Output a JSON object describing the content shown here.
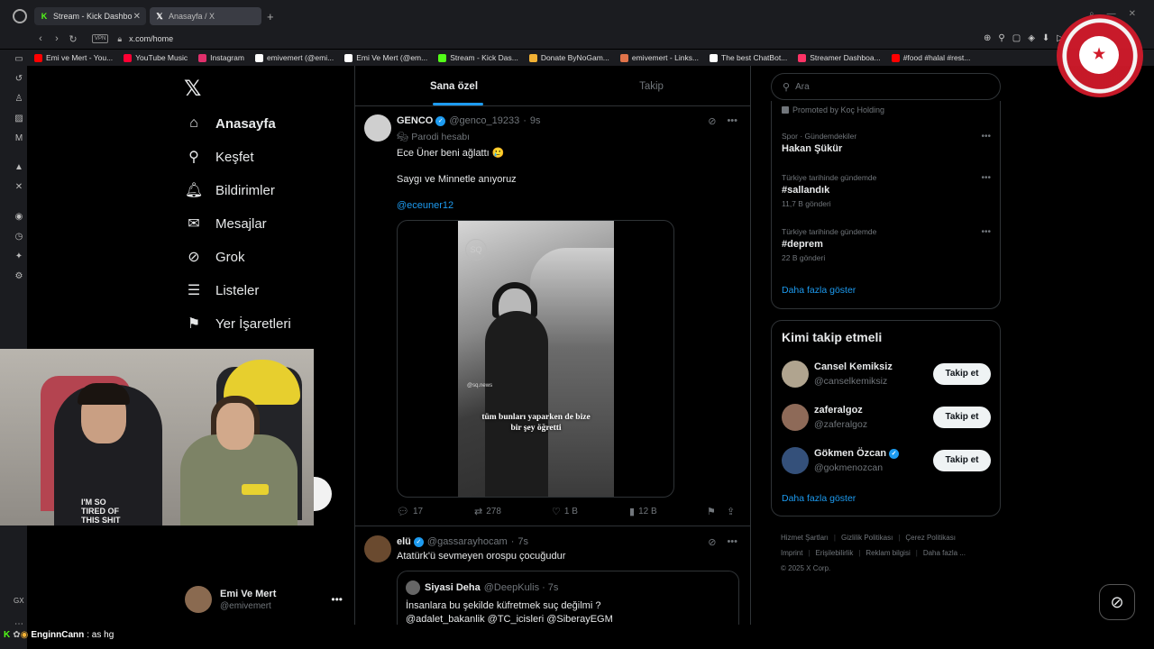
{
  "browser": {
    "tabs": [
      {
        "label": "Stream - Kick Dashbo",
        "active": true
      },
      {
        "label": "Anasayfa / X",
        "active": false
      }
    ],
    "address": "x.com/home",
    "vpn": "VPN",
    "bookmarks": [
      {
        "label": "Emi ve Mert - You...",
        "color": "#ff0000"
      },
      {
        "label": "YouTube Music",
        "color": "#ff0033"
      },
      {
        "label": "Instagram",
        "color": "#e1306c"
      },
      {
        "label": "emivemert (@emi...",
        "color": "#ffffff"
      },
      {
        "label": "Emi Ve Mert (@em...",
        "color": "#ffffff"
      },
      {
        "label": "Stream - Kick Das...",
        "color": "#53fc18"
      },
      {
        "label": "Donate ByNoGam...",
        "color": "#f2b134"
      },
      {
        "label": "emivemert - Links...",
        "color": "#e0734a"
      },
      {
        "label": "The best ChatBot...",
        "color": "#ffffff"
      },
      {
        "label": "Streamer Dashboa...",
        "color": "#ff3366"
      },
      {
        "label": "#food #halal #rest...",
        "color": "#ff0000"
      }
    ],
    "gx_label": "GX"
  },
  "x_nav": {
    "items": [
      {
        "label": "Anasayfa",
        "icon": "home-icon",
        "glyph": "⌂"
      },
      {
        "label": "Keşfet",
        "icon": "search-icon",
        "glyph": "⚲"
      },
      {
        "label": "Bildirimler",
        "icon": "bell-icon",
        "glyph": "🔔︎"
      },
      {
        "label": "Mesajlar",
        "icon": "mail-icon",
        "glyph": "✉"
      },
      {
        "label": "Grok",
        "icon": "grok-icon",
        "glyph": "⊘"
      },
      {
        "label": "Listeler",
        "icon": "list-icon",
        "glyph": "☰"
      },
      {
        "label": "Yer İşaretleri",
        "icon": "bookmark-icon",
        "glyph": "⚑"
      }
    ],
    "account": {
      "name": "Emi Ve Mert",
      "handle": "@emivemert"
    }
  },
  "timeline": {
    "tabs": [
      "Sana özel",
      "Takip"
    ],
    "tweet1": {
      "name": "GENCO",
      "handle": "@genco_19233",
      "time": "9s",
      "badge": "Parodi hesabı",
      "line1": "Ece Üner beni ağlattı 🥲",
      "line2": "Saygı ve Minnetle anıyoruz",
      "mention": "@eceuner12",
      "media_caption_1": "tüm bunları yaparken de bize",
      "media_caption_2": "bir şey öğretti",
      "media_sq": "SQ",
      "media_wm": "@sq.news",
      "replies": "17",
      "reposts": "278",
      "likes": "1 B",
      "views": "12 B"
    },
    "tweet2": {
      "name": "elü",
      "handle": "@gassarayhocam",
      "time": "7s",
      "text": "Atatürk'ü sevmeyen orospu çocuğudur",
      "quote": {
        "name": "Siyasi Deha",
        "handle": "@DeepKulis",
        "time": "7s",
        "line1": "İnsanlara bu şekilde küfretmek suç değilmi ?",
        "line2": "@adalet_bakanlik @TC_icisleri @SiberayEGM"
      }
    }
  },
  "right": {
    "search_placeholder": "Ara",
    "promoted": "Promoted by Koç Holding",
    "trends": [
      {
        "context": "Spor · Gündemdekiler",
        "title": "Hakan Şükür",
        "count": ""
      },
      {
        "context": "Türkiye tarihinde gündemde",
        "title": "#sallandık",
        "count": "11,7 B gönderi"
      },
      {
        "context": "Türkiye tarihinde gündemde",
        "title": "#deprem",
        "count": "22 B gönderi"
      }
    ],
    "show_more": "Daha fazla göster",
    "who_to_follow": {
      "heading": "Kimi takip etmeli",
      "users": [
        {
          "name": "Cansel Kemiksiz",
          "handle": "@canselkemiksiz",
          "verified": false
        },
        {
          "name": "zaferalgoz",
          "handle": "@zaferalgoz",
          "verified": false
        },
        {
          "name": "Gökmen Özcan",
          "handle": "@gokmenozcan",
          "verified": true
        }
      ],
      "follow_label": "Takip et",
      "show_more": "Daha fazla göster"
    },
    "footer": [
      "Hizmet Şartları",
      "Gizlilik Politikası",
      "Çerez Politikası",
      "Imprint",
      "Erişilebilirlik",
      "Reklam bilgisi",
      "Daha fazla ...",
      "© 2025 X Corp."
    ]
  },
  "webcam": {
    "shirt_text_1": "I'M SO",
    "shirt_text_2": "TIRED OF",
    "shirt_text_3": "THIS SHIT"
  },
  "chat": {
    "user": "EnginnCann",
    "message": ": as hg"
  }
}
